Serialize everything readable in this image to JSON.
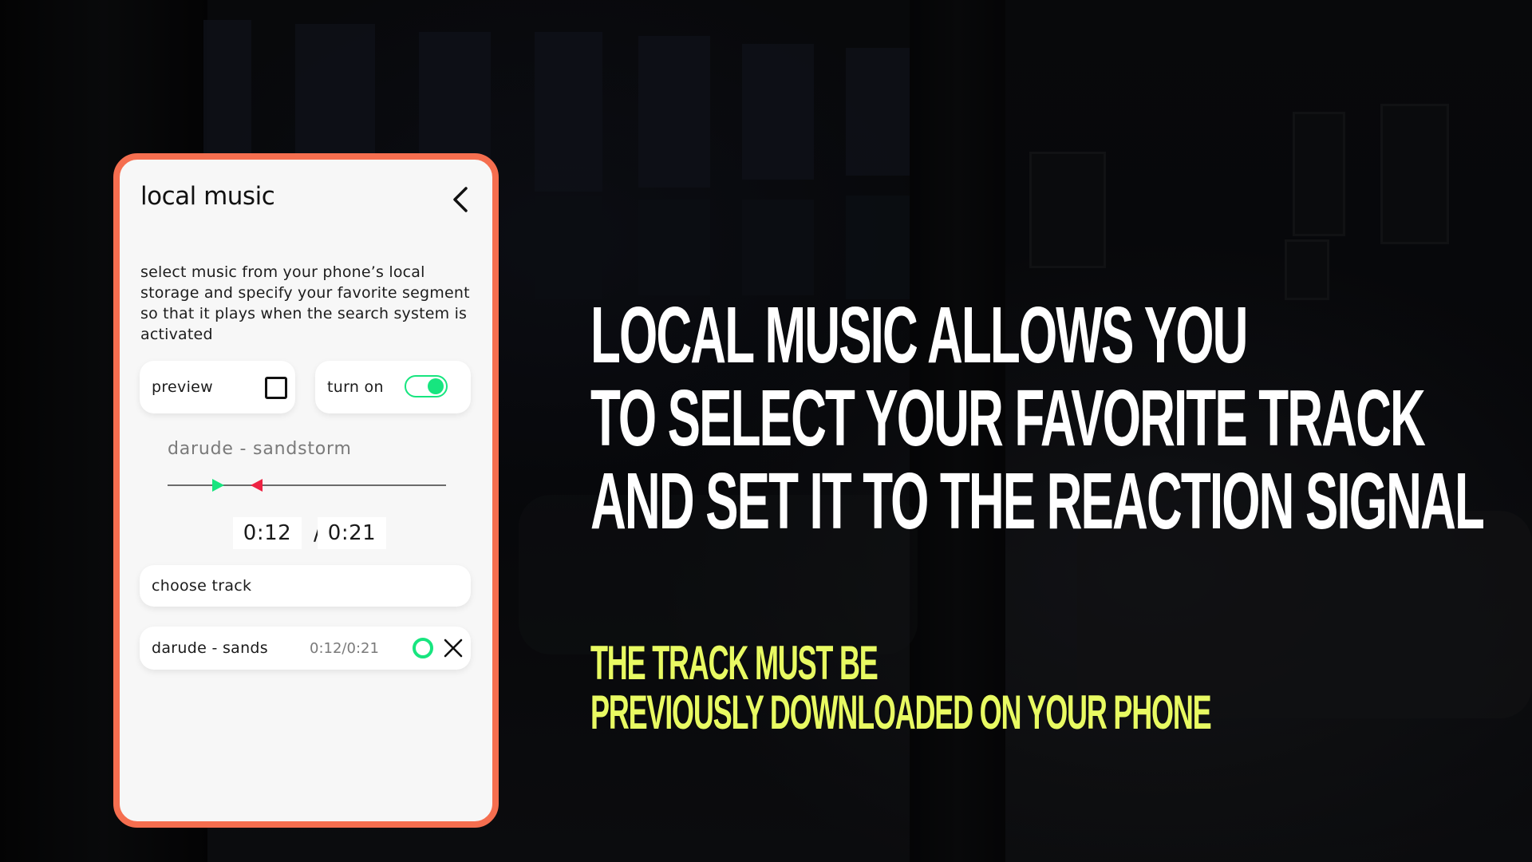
{
  "colors": {
    "card_border": "#f56e4f",
    "accent_green": "#17e57f",
    "accent_red": "#ee2343",
    "headline": "#ffffff",
    "subline": "#e8fa62"
  },
  "phone": {
    "title": "local music",
    "back_icon": "chevron-left-icon",
    "description": "select music from your phone’s local storage and specify your favorite segment so that it plays when the search system is activated",
    "preview": {
      "label": "preview",
      "checked": false
    },
    "turn_on": {
      "label": "turn on",
      "enabled": true
    },
    "player": {
      "track_name": "darude - sandstorm",
      "segment_start": "0:12",
      "segment_end": "0:21",
      "separator": "/",
      "start_fraction": 0.18,
      "end_fraction": 0.32
    },
    "choose_track_label": "choose track",
    "saved_tracks": [
      {
        "name": "darude - sands",
        "segment": "0:12/0:21",
        "status_icon": "ring-icon",
        "remove_icon": "close-icon"
      }
    ]
  },
  "headline": {
    "lines": [
      "LOCAL MUSIC ALLOWS YOU",
      "TO SELECT YOUR FAVORITE TRACK",
      "AND SET IT TO THE REACTION SIGNAL"
    ]
  },
  "note": {
    "lines": [
      "THE TRACK MUST BE",
      "PREVIOUSLY DOWNLOADED ON YOUR PHONE"
    ]
  }
}
